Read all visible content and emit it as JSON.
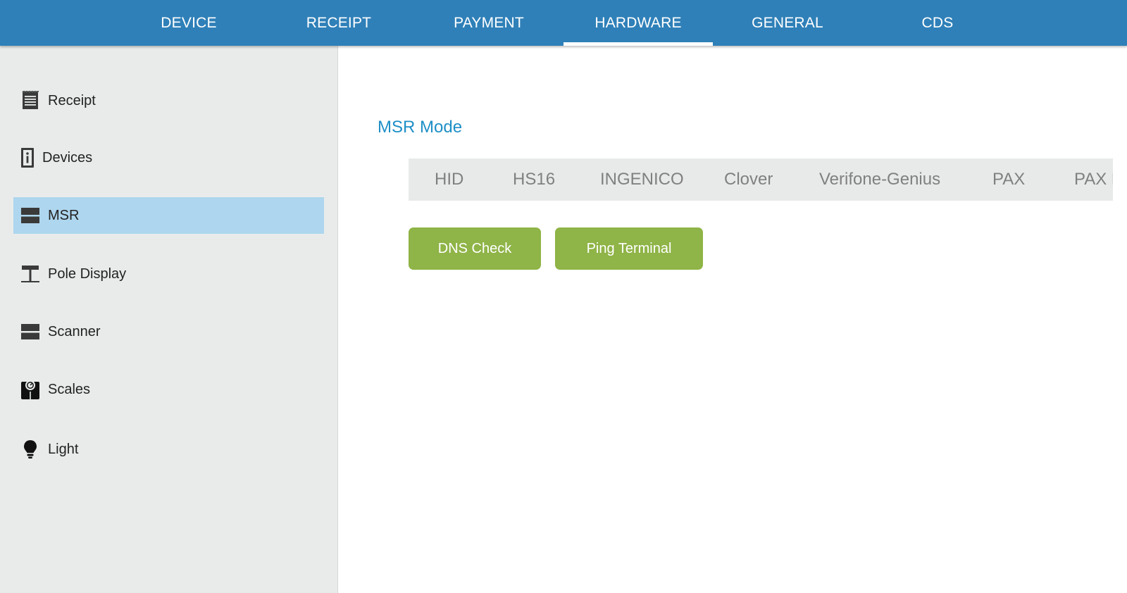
{
  "tabs": [
    {
      "label": "DEVICE"
    },
    {
      "label": "RECEIPT"
    },
    {
      "label": "PAYMENT"
    },
    {
      "label": "HARDWARE",
      "active": true
    },
    {
      "label": "GENERAL"
    },
    {
      "label": "CDS"
    }
  ],
  "sidebar": {
    "items": [
      {
        "label": "Receipt",
        "icon": "receipt-icon"
      },
      {
        "label": "Devices",
        "icon": "devices-icon"
      },
      {
        "label": "MSR",
        "icon": "msr-icon",
        "active": true
      },
      {
        "label": "Pole Display",
        "icon": "pole-display-icon"
      },
      {
        "label": "Scanner",
        "icon": "scanner-icon"
      },
      {
        "label": "Scales",
        "icon": "scales-icon"
      },
      {
        "label": "Light",
        "icon": "light-bulb-icon"
      }
    ]
  },
  "main": {
    "section_title": "MSR Mode",
    "modes": [
      "HID",
      "HS16",
      "INGENICO",
      "Clover",
      "Verifone-Genius",
      "PAX",
      "PAX E"
    ],
    "buttons": {
      "dns_check": "DNS Check",
      "ping_terminal": "Ping Terminal"
    }
  },
  "colors": {
    "header": "#2f80b8",
    "sidebar_bg": "#e9ebeb",
    "sidebar_active": "#aed6ee",
    "title_accent": "#1f8fc7",
    "button_green": "#8fb447",
    "segment_bg": "#e8eaea"
  }
}
